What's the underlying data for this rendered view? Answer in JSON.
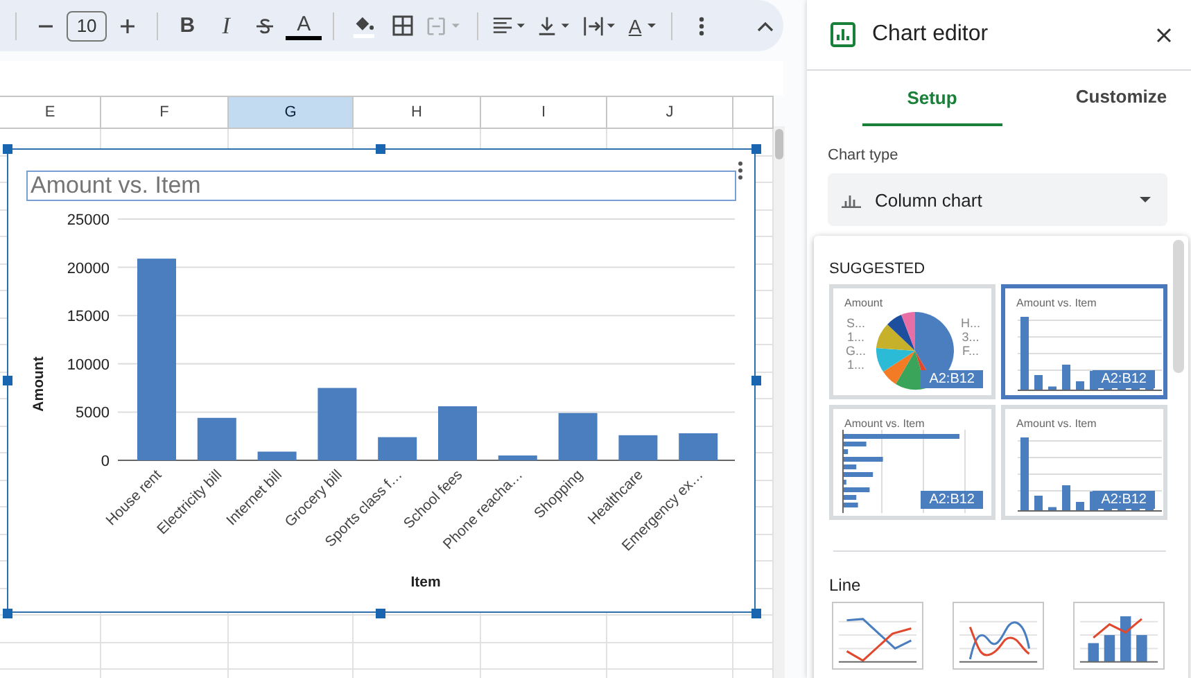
{
  "toolbar": {
    "font_size": "10",
    "bold_label": "B",
    "italic_label": "I",
    "text_color_label": "A",
    "rotate_label": "A",
    "merge_disabled": true
  },
  "columns": [
    {
      "label": "E",
      "selected": false
    },
    {
      "label": "F",
      "selected": false
    },
    {
      "label": "G",
      "selected": true
    },
    {
      "label": "H",
      "selected": false
    },
    {
      "label": "I",
      "selected": false
    },
    {
      "label": "J",
      "selected": false
    }
  ],
  "chart": {
    "title": "Amount vs. Item",
    "chart_data": {
      "type": "bar",
      "xlabel": "Item",
      "ylabel": "Amount",
      "categories": [
        "House rent",
        "Electricity bill",
        "Internet bill",
        "Grocery bill",
        "Sports class f…",
        "School fees",
        "Phone reacha…",
        "Shopping",
        "Healthcare",
        "Emergency ex…"
      ],
      "values": [
        20900,
        4400,
        900,
        7500,
        2400,
        5600,
        500,
        4900,
        2600,
        2800
      ],
      "grid": true,
      "ylim": [
        0,
        25000
      ],
      "yticks": [
        0,
        5000,
        10000,
        15000,
        20000,
        25000
      ]
    }
  },
  "editor": {
    "title": "Chart editor",
    "tabs": [
      {
        "label": "Setup",
        "selected": true
      },
      {
        "label": "Customize",
        "selected": false
      }
    ],
    "chart_type_label": "Chart type",
    "chart_type_value": "Column chart",
    "suggested_heading": "SUGGESTED",
    "suggestions": [
      {
        "kind": "pie",
        "title": "Amount",
        "range": "A2:B12",
        "left_labels": [
          "S...",
          "1...",
          "G...",
          "1..."
        ],
        "right_labels": [
          "H...",
          "3...",
          "F..."
        ],
        "selected": false
      },
      {
        "kind": "column",
        "title": "Amount vs. Item",
        "range": "A2:B12",
        "selected": true
      },
      {
        "kind": "bar",
        "title": "Amount vs. Item",
        "range": "A2:B12",
        "selected": false
      },
      {
        "kind": "column",
        "title": "Amount vs. Item",
        "range": "A2:B12",
        "selected": false
      }
    ],
    "line_heading": "Line",
    "line_options": [
      {
        "kind": "line"
      },
      {
        "kind": "smooth"
      },
      {
        "kind": "combo"
      }
    ]
  }
}
